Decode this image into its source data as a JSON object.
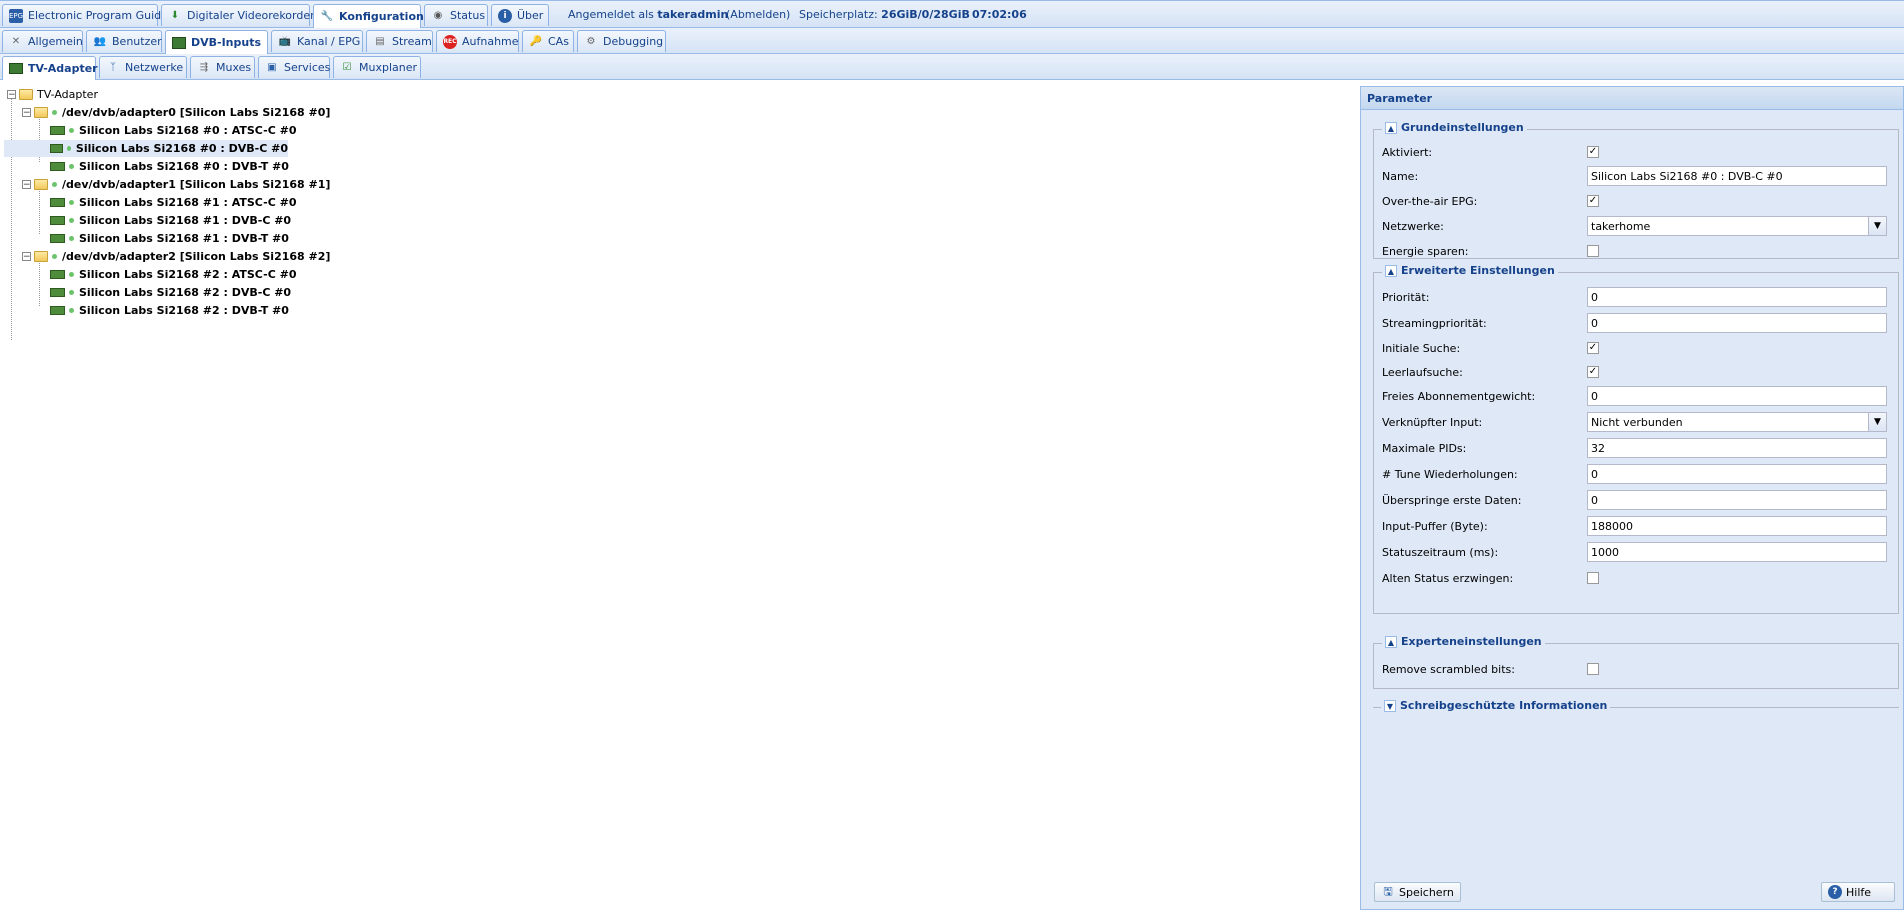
{
  "topnav": {
    "tabs": [
      {
        "label": "Electronic Program Guide",
        "icon": "epg-icon"
      },
      {
        "label": "Digitaler Videorekorder",
        "icon": "dvr-icon"
      },
      {
        "label": "Konfiguration",
        "icon": "wrench-icon"
      },
      {
        "label": "Status",
        "icon": "eye-icon"
      },
      {
        "label": "Über",
        "icon": "info-icon"
      }
    ],
    "active": "Konfiguration",
    "logged_in_prefix": "Angemeldet als",
    "username": "takeradmin",
    "logout": "(Abmelden)",
    "storage_prefix": "Speicherplatz:",
    "storage_value": "26GiB/0/28GiB",
    "clock": "07:02:06"
  },
  "subnav": {
    "tabs": [
      {
        "label": "Allgemein",
        "icon": "tools-icon"
      },
      {
        "label": "Benutzer",
        "icon": "users-icon"
      },
      {
        "label": "DVB-Inputs",
        "icon": "dvb-icon"
      },
      {
        "label": "Kanal / EPG",
        "icon": "tv-icon"
      },
      {
        "label": "Stream",
        "icon": "stream-icon"
      },
      {
        "label": "Aufnahme",
        "icon": "rec-icon"
      },
      {
        "label": "CAs",
        "icon": "key-icon"
      },
      {
        "label": "Debugging",
        "icon": "bug-icon"
      }
    ],
    "active": "DVB-Inputs"
  },
  "dvbnav": {
    "tabs": [
      {
        "label": "TV-Adapter",
        "icon": "card-icon"
      },
      {
        "label": "Netzwerke",
        "icon": "antenna-icon"
      },
      {
        "label": "Muxes",
        "icon": "mux-icon"
      },
      {
        "label": "Services",
        "icon": "services-icon"
      },
      {
        "label": "Muxplaner",
        "icon": "scheduler-icon"
      }
    ],
    "active": "TV-Adapter"
  },
  "tree": {
    "root": "TV-Adapter",
    "adapters": [
      {
        "label": "/dev/dvb/adapter0 [Silicon Labs Si2168 #0]",
        "frontends": [
          "Silicon Labs Si2168 #0 : ATSC-C #0",
          "Silicon Labs Si2168 #0 : DVB-C #0",
          "Silicon Labs Si2168 #0 : DVB-T #0"
        ]
      },
      {
        "label": "/dev/dvb/adapter1 [Silicon Labs Si2168 #1]",
        "frontends": [
          "Silicon Labs Si2168 #1 : ATSC-C #0",
          "Silicon Labs Si2168 #1 : DVB-C #0",
          "Silicon Labs Si2168 #1 : DVB-T #0"
        ]
      },
      {
        "label": "/dev/dvb/adapter2 [Silicon Labs Si2168 #2]",
        "frontends": [
          "Silicon Labs Si2168 #2 : ATSC-C #0",
          "Silicon Labs Si2168 #2 : DVB-C #0",
          "Silicon Labs Si2168 #2 : DVB-T #0"
        ]
      }
    ],
    "selected": "Silicon Labs Si2168 #0 : DVB-C #0"
  },
  "panel": {
    "title": "Parameter",
    "basic": {
      "title": "Grundeinstellungen",
      "aktiviert_label": "Aktiviert:",
      "aktiviert": true,
      "name_label": "Name:",
      "name_value": "Silicon Labs Si2168 #0 : DVB-C #0",
      "ota_label": "Over-the-air EPG:",
      "ota": true,
      "netzwerke_label": "Netzwerke:",
      "netzwerke_value": "takerhome",
      "energie_label": "Energie sparen:",
      "energie": false
    },
    "advanced": {
      "title": "Erweiterte Einstellungen",
      "prio_label": "Priorität:",
      "prio_value": "0",
      "sprio_label": "Streamingpriorität:",
      "sprio_value": "0",
      "init_label": "Initiale Suche:",
      "init": true,
      "idle_label": "Leerlaufsuche:",
      "idle": true,
      "weight_label": "Freies Abonnementgewicht:",
      "weight_value": "0",
      "linked_label": "Verknüpfter Input:",
      "linked_value": "Nicht verbunden",
      "pids_label": "Maximale PIDs:",
      "pids_value": "32",
      "tune_label": "# Tune Wiederholungen:",
      "tune_value": "0",
      "skip_label": "Überspringe erste Daten:",
      "skip_value": "0",
      "buffer_label": "Input-Puffer (Byte):",
      "buffer_value": "188000",
      "status_label": "Statuszeitraum (ms):",
      "status_value": "1000",
      "force_label": "Alten Status erzwingen:",
      "force": false
    },
    "expert": {
      "title": "Experteneinstellungen",
      "scrambled_label": "Remove scrambled bits:",
      "scrambled": false
    },
    "readonly": {
      "title": "Schreibgeschützte Informationen"
    },
    "save_label": "Speichern",
    "help_label": "Hilfe"
  }
}
